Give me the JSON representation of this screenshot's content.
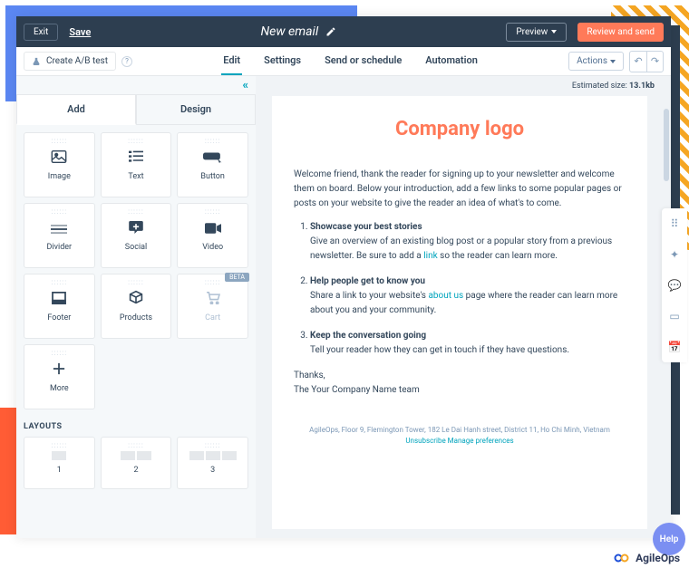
{
  "topbar": {
    "exit": "Exit",
    "save": "Save",
    "title": "New email",
    "preview": "Preview",
    "review": "Review and send"
  },
  "subbar": {
    "ab": "Create A/B test",
    "actions": "Actions"
  },
  "main_tabs": [
    "Edit",
    "Settings",
    "Send or schedule",
    "Automation"
  ],
  "side_tabs": [
    "Add",
    "Design"
  ],
  "blocks": [
    {
      "label": "Image"
    },
    {
      "label": "Text"
    },
    {
      "label": "Button"
    },
    {
      "label": "Divider"
    },
    {
      "label": "Social"
    },
    {
      "label": "Video"
    },
    {
      "label": "Footer"
    },
    {
      "label": "Products"
    },
    {
      "label": "Cart",
      "beta": "BETA"
    },
    {
      "label": "More"
    }
  ],
  "layouts_title": "LAYOUTS",
  "layouts": [
    {
      "label": "1",
      "cols": 1
    },
    {
      "label": "2",
      "cols": 2
    },
    {
      "label": "3",
      "cols": 3
    }
  ],
  "estimated": {
    "pre": "Estimated size: ",
    "val": "13.1kb"
  },
  "email": {
    "logo": "Company logo",
    "welcome": "Welcome friend, thank the reader for signing up to your newsletter and welcome them on board. Below your introduction, add a few links to some popular pages or posts on your website to give the reader an idea of what's to come.",
    "items": [
      {
        "h": "Showcase your best stories",
        "p1": "Give an overview of an existing blog post or a popular story from a previous newsletter. Be sure to add a ",
        "link": "link",
        "p2": " so the reader can learn more."
      },
      {
        "h": "Help people get to know you",
        "p1": "Share a link to your website's ",
        "link": "about us",
        "p2": " page where the reader can learn more about you and your community."
      },
      {
        "h": "Keep the conversation going",
        "p1": "Tell your reader how they can get in touch if they have questions.",
        "link": "",
        "p2": ""
      }
    ],
    "thanks": "Thanks,",
    "team": "The Your Company Name team",
    "footer_addr": "AgileOps, Floor 9, Flemington Tower, 182 Le Dai Hanh street, District 11, Ho Chi Minh, Vietnam",
    "footer_unsub": "Unsubscribe",
    "footer_manage": "Manage preferences"
  },
  "help": "Help",
  "brand": "AgileOps"
}
